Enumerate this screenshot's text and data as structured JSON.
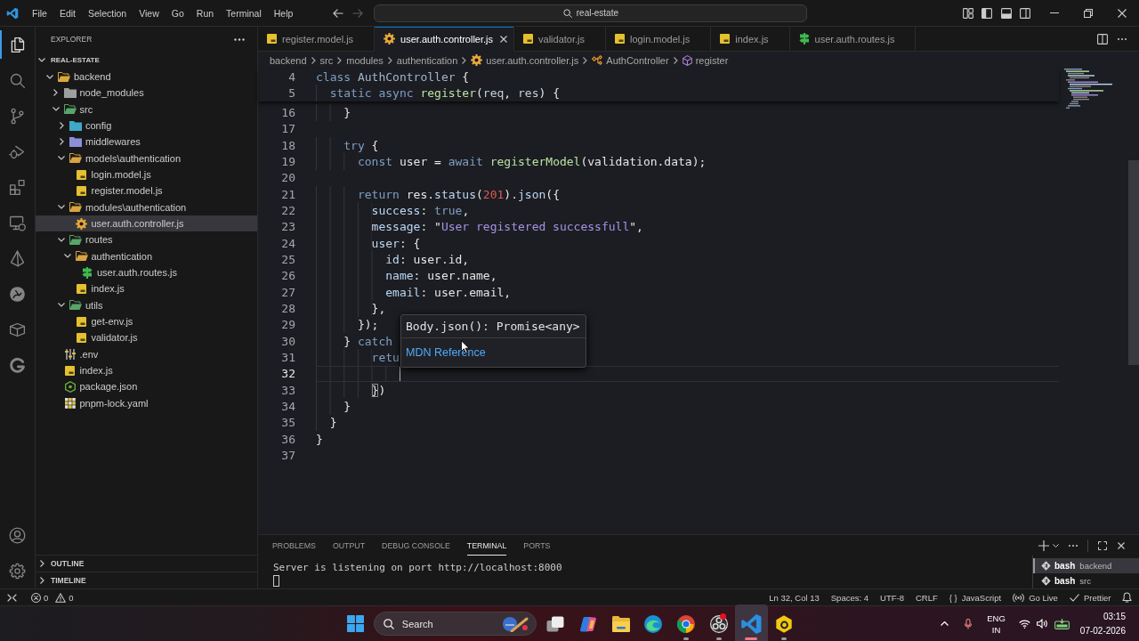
{
  "title_bar": {
    "menus": [
      "File",
      "Edit",
      "Selection",
      "View",
      "Go",
      "Run",
      "Terminal",
      "Help"
    ],
    "navigation": [
      {
        "kind": "back",
        "disabled": false
      },
      {
        "kind": "forward",
        "disabled": true
      }
    ],
    "command_center": "real-estate"
  },
  "activity_bar": {
    "items": [
      {
        "kind": "explorer",
        "selected": true
      },
      {
        "kind": "search",
        "selected": false
      },
      {
        "kind": "scm",
        "selected": false
      },
      {
        "kind": "debug",
        "selected": false
      },
      {
        "kind": "extensions",
        "selected": false
      },
      {
        "kind": "remote",
        "selected": false
      },
      {
        "kind": "prisma",
        "selected": false
      },
      {
        "kind": "rabbit",
        "selected": false
      },
      {
        "kind": "box",
        "selected": false
      },
      {
        "kind": "glogo",
        "selected": false
      }
    ],
    "bottom_items": [
      {
        "kind": "account"
      },
      {
        "kind": "settings"
      }
    ]
  },
  "sidebar": {
    "title": "EXPLORER",
    "root": {
      "label": "REAL-ESTATE",
      "expanded": true
    },
    "tree": [
      {
        "label": "backend",
        "kind": "folder",
        "color": "#d9a93a",
        "expanded": true,
        "selected": false,
        "children": [
          {
            "label": "node_modules",
            "kind": "folder",
            "color": "#9e9e9e",
            "expanded": false,
            "selected": false
          },
          {
            "label": "src",
            "kind": "folder",
            "color": "#5aa469",
            "expanded": true,
            "selected": false,
            "children": [
              {
                "label": "config",
                "kind": "folder",
                "color": "#3fa9c9",
                "expanded": false,
                "selected": false
              },
              {
                "label": "middlewares",
                "kind": "folder",
                "color": "#8c8fd8",
                "expanded": false,
                "selected": false
              },
              {
                "label": "models\\authentication",
                "kind": "folder",
                "color": "#d9a441",
                "expanded": true,
                "selected": false,
                "children": [
                  {
                    "label": "login.model.js",
                    "kind": "js",
                    "selected": false
                  },
                  {
                    "label": "register.model.js",
                    "kind": "js",
                    "selected": false
                  }
                ]
              },
              {
                "label": "modules\\authentication",
                "kind": "folder",
                "color": "#d9a441",
                "expanded": true,
                "selected": false,
                "children": [
                  {
                    "label": "user.auth.controller.js",
                    "kind": "controller",
                    "selected": true
                  }
                ]
              },
              {
                "label": "routes",
                "kind": "folder",
                "color": "#5aa469",
                "expanded": true,
                "selected": false,
                "children": [
                  {
                    "label": "authentication",
                    "kind": "folder",
                    "color": "#d9a441",
                    "expanded": true,
                    "selected": false,
                    "children": [
                      {
                        "label": "user.auth.routes.js",
                        "kind": "routes",
                        "selected": false
                      }
                    ]
                  },
                  {
                    "label": "index.js",
                    "kind": "js",
                    "selected": false
                  }
                ]
              },
              {
                "label": "utils",
                "kind": "folder",
                "color": "#5aa469",
                "expanded": true,
                "selected": false,
                "children": [
                  {
                    "label": "get-env.js",
                    "kind": "js",
                    "selected": false
                  },
                  {
                    "label": "validator.js",
                    "kind": "js",
                    "selected": false
                  }
                ]
              }
            ]
          },
          {
            "label": ".env",
            "kind": "env",
            "selected": false
          },
          {
            "label": "index.js",
            "kind": "js",
            "selected": false
          },
          {
            "label": "package.json",
            "kind": "package",
            "selected": false
          },
          {
            "label": "pnpm-lock.yaml",
            "kind": "lock",
            "selected": false
          }
        ]
      }
    ],
    "sections": [
      {
        "label": "OUTLINE",
        "expanded": false
      },
      {
        "label": "TIMELINE",
        "expanded": false
      }
    ]
  },
  "editor": {
    "tabs": [
      {
        "label": "register.model.js",
        "kind": "js",
        "selected": false
      },
      {
        "label": "user.auth.controller.js",
        "kind": "controller",
        "selected": true
      },
      {
        "label": "validator.js",
        "kind": "js",
        "selected": false
      },
      {
        "label": "login.model.js",
        "kind": "js",
        "selected": false
      },
      {
        "label": "index.js",
        "kind": "js",
        "selected": false
      },
      {
        "label": "user.auth.routes.js",
        "kind": "routes",
        "selected": false
      }
    ],
    "breadcrumbs": [
      {
        "label": "backend",
        "kind": "folder"
      },
      {
        "label": "src",
        "kind": "folder"
      },
      {
        "label": "modules",
        "kind": "folder"
      },
      {
        "label": "authentication",
        "kind": "folder"
      },
      {
        "label": "user.auth.controller.js",
        "kind": "controller"
      },
      {
        "label": "AuthController",
        "kind": "class"
      },
      {
        "label": "register",
        "kind": "method"
      }
    ],
    "sticky_lines": [
      {
        "number": "4",
        "tokens": [
          {
            "kind": "kw",
            "text": "class"
          },
          {
            "kind": "type",
            "text": " AuthController"
          },
          {
            "kind": "plain",
            "text": " {"
          }
        ]
      },
      {
        "number": "5",
        "tokens": [
          {
            "kind": "kw",
            "text": "  static"
          },
          {
            "kind": "kw",
            "text": " async"
          },
          {
            "kind": "fn",
            "text": " register"
          },
          {
            "kind": "plain",
            "text": "("
          },
          {
            "kind": "param",
            "text": "req"
          },
          {
            "kind": "plain",
            "text": ", "
          },
          {
            "kind": "param",
            "text": "res"
          },
          {
            "kind": "plain",
            "text": ") {"
          }
        ]
      }
    ],
    "lines": [
      {
        "number": "16",
        "current": false,
        "tokens": [
          {
            "kind": "plain",
            "text": "    }"
          }
        ]
      },
      {
        "number": "17",
        "current": false
      },
      {
        "number": "18",
        "current": false,
        "tokens": [
          {
            "kind": "kw",
            "text": "    try"
          },
          {
            "kind": "plain",
            "text": " {"
          }
        ]
      },
      {
        "number": "19",
        "current": false,
        "tokens": [
          {
            "kind": "kw",
            "text": "      const"
          },
          {
            "kind": "plain",
            "text": " user = "
          },
          {
            "kind": "kw",
            "text": "await"
          },
          {
            "kind": "fn",
            "text": " registerModel"
          },
          {
            "kind": "plain",
            "text": "(validation.data);"
          }
        ]
      },
      {
        "number": "20",
        "current": false
      },
      {
        "number": "21",
        "current": false,
        "tokens": [
          {
            "kind": "kw",
            "text": "      return"
          },
          {
            "kind": "plain",
            "text": " res."
          },
          {
            "kind": "prop",
            "text": "status"
          },
          {
            "kind": "plain",
            "text": "("
          },
          {
            "kind": "num",
            "text": "201"
          },
          {
            "kind": "plain",
            "text": ")."
          },
          {
            "kind": "prop",
            "text": "json"
          },
          {
            "kind": "plain",
            "text": "({"
          }
        ]
      },
      {
        "number": "22",
        "current": false,
        "tokens": [
          {
            "kind": "prop",
            "text": "        success"
          },
          {
            "kind": "plain",
            "text": ": "
          },
          {
            "kind": "kw",
            "text": "true"
          },
          {
            "kind": "plain",
            "text": ","
          }
        ]
      },
      {
        "number": "23",
        "current": false,
        "tokens": [
          {
            "kind": "prop",
            "text": "        message"
          },
          {
            "kind": "plain",
            "text": ": \""
          },
          {
            "kind": "str",
            "text": "User registered successfull"
          },
          {
            "kind": "plain",
            "text": "\","
          }
        ]
      },
      {
        "number": "24",
        "current": false,
        "tokens": [
          {
            "kind": "prop",
            "text": "        user"
          },
          {
            "kind": "plain",
            "text": ": {"
          }
        ]
      },
      {
        "number": "25",
        "current": false,
        "tokens": [
          {
            "kind": "prop",
            "text": "          id"
          },
          {
            "kind": "plain",
            "text": ": user.id,"
          }
        ]
      },
      {
        "number": "26",
        "current": false,
        "tokens": [
          {
            "kind": "prop",
            "text": "          name"
          },
          {
            "kind": "plain",
            "text": ": user.name,"
          }
        ]
      },
      {
        "number": "27",
        "current": false,
        "tokens": [
          {
            "kind": "prop",
            "text": "          email"
          },
          {
            "kind": "plain",
            "text": ": user.email,"
          }
        ]
      },
      {
        "number": "28",
        "current": false,
        "tokens": [
          {
            "kind": "plain",
            "text": "        },"
          }
        ]
      },
      {
        "number": "29",
        "current": false,
        "tokens": [
          {
            "kind": "plain",
            "text": "      });"
          }
        ]
      },
      {
        "number": "30",
        "current": false,
        "tokens": [
          {
            "kind": "plain",
            "text": "    } "
          },
          {
            "kind": "kw",
            "text": "catch"
          }
        ]
      },
      {
        "number": "31",
        "current": false,
        "tokens": [
          {
            "kind": "kw",
            "text": "        retu"
          }
        ]
      },
      {
        "number": "32",
        "current": true
      },
      {
        "number": "33",
        "current": false,
        "tokens": [
          {
            "kind": "match",
            "text": "        }"
          },
          {
            "kind": "plain",
            "text": ")"
          }
        ]
      },
      {
        "number": "34",
        "current": false,
        "tokens": [
          {
            "kind": "plain",
            "text": "    }"
          }
        ]
      },
      {
        "number": "35",
        "current": false,
        "tokens": [
          {
            "kind": "plain",
            "text": "  }"
          }
        ]
      },
      {
        "number": "36",
        "current": false,
        "tokens": [
          {
            "kind": "plain",
            "text": "}"
          }
        ]
      },
      {
        "number": "37",
        "current": false
      }
    ],
    "hover": {
      "signature": "Body.json(): Promise<any>",
      "link": "MDN Reference"
    }
  },
  "panel": {
    "tabs": [
      {
        "label": "PROBLEMS",
        "selected": false
      },
      {
        "label": "OUTPUT",
        "selected": false
      },
      {
        "label": "DEBUG CONSOLE",
        "selected": false
      },
      {
        "label": "TERMINAL",
        "selected": true
      },
      {
        "label": "PORTS",
        "selected": false
      }
    ],
    "terminal_output": [
      "Server is listening on port http://localhost:8000"
    ],
    "terminals": [
      {
        "shell": "bash",
        "folder": "backend",
        "selected": true
      },
      {
        "shell": "bash",
        "folder": "src",
        "selected": false
      }
    ]
  },
  "status_bar": {
    "errors": "0",
    "warnings": "0",
    "items": [
      {
        "kind": "text",
        "label": "Ln 32, Col 13"
      },
      {
        "kind": "text",
        "label": "Spaces: 4"
      },
      {
        "kind": "text",
        "label": "UTF-8"
      },
      {
        "kind": "text",
        "label": "CRLF"
      },
      {
        "kind": "language",
        "symbol": "{ }",
        "label": "JavaScript"
      },
      {
        "kind": "live",
        "label": "Go Live"
      },
      {
        "kind": "check",
        "label": "Prettier"
      }
    ]
  },
  "taskbar": {
    "search": {
      "placeholder": "Search"
    },
    "apps": [
      {
        "kind": "copilot",
        "running": false,
        "selected": false,
        "notification": false
      },
      {
        "kind": "files",
        "running": false,
        "selected": false,
        "notification": false
      },
      {
        "kind": "edge",
        "running": false,
        "selected": false,
        "notification": false
      },
      {
        "kind": "chrome",
        "running": true,
        "selected": false,
        "notification": false
      },
      {
        "kind": "obs",
        "running": true,
        "selected": false,
        "notification": true
      },
      {
        "kind": "vscode",
        "running": true,
        "selected": true,
        "notification": false
      },
      {
        "kind": "bee",
        "running": true,
        "selected": false,
        "notification": false
      }
    ],
    "tray": {
      "language": [
        "ENG",
        "IN"
      ],
      "time": "03:15",
      "date": "07-02-2026"
    }
  }
}
